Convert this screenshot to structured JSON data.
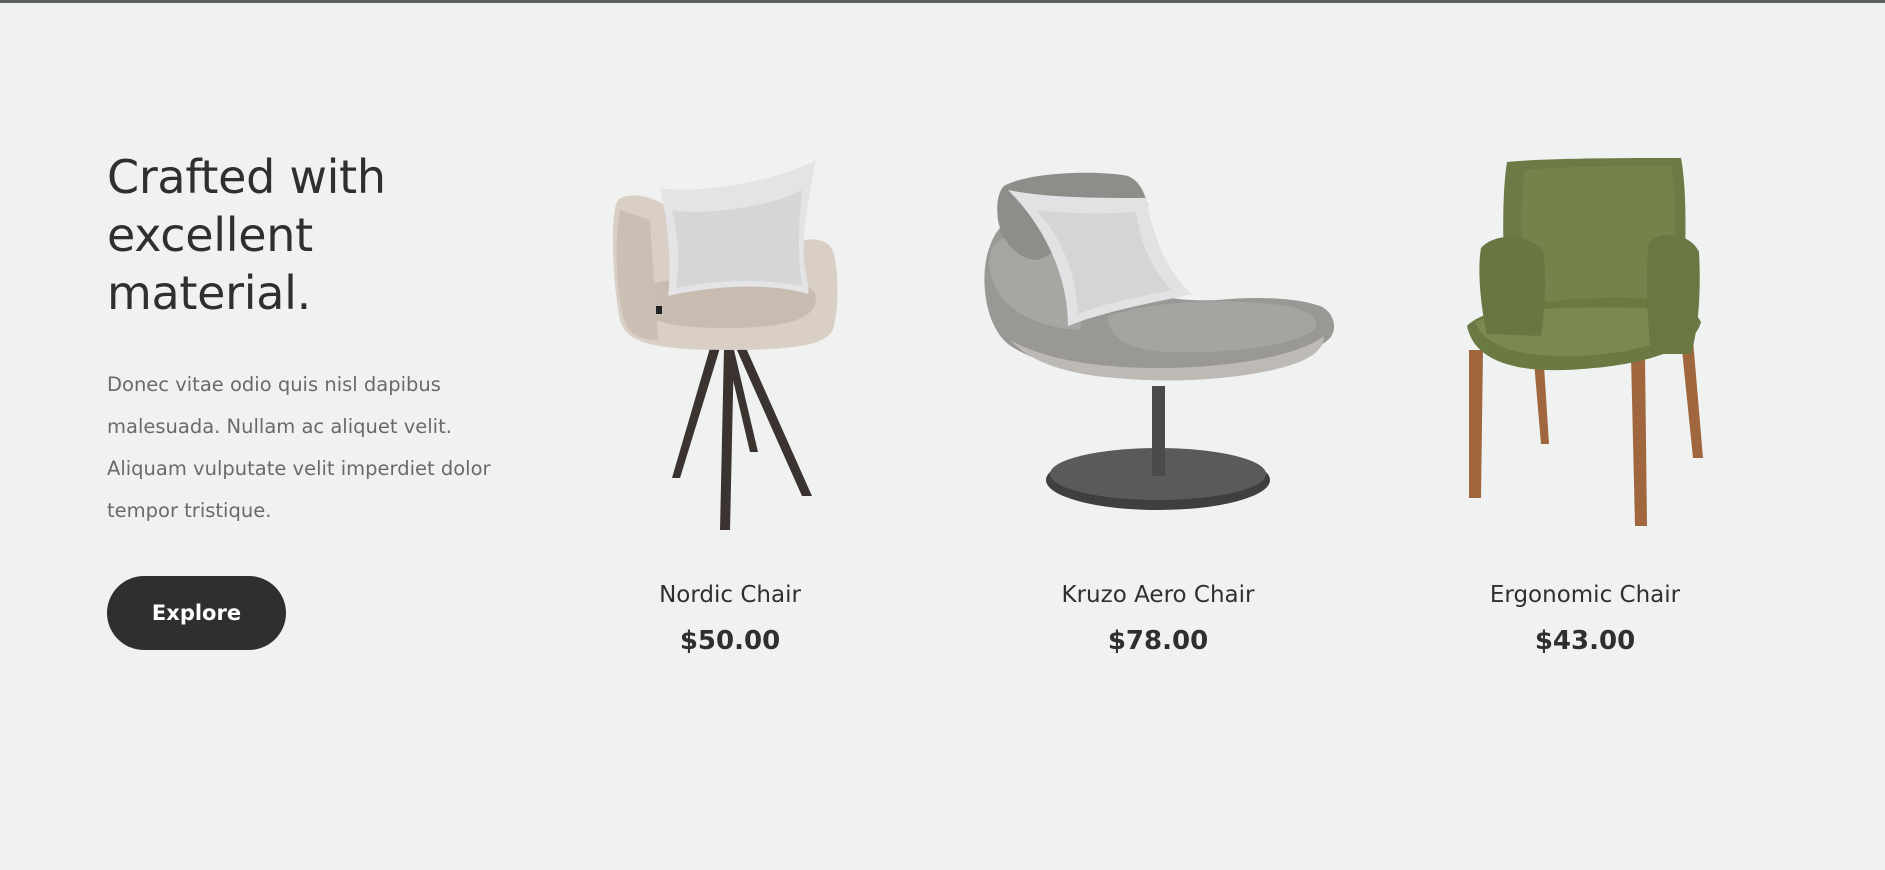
{
  "section": {
    "heading": "Crafted with excellent material.",
    "description": "Donec vitae odio quis nisl dapibus malesuada. Nullam ac aliquet velit. Aliquam vulputate velit imperdiet dolor tempor tristique.",
    "explore_label": "Explore"
  },
  "products": [
    {
      "name": "Nordic Chair",
      "price": "$50.00",
      "icon": "nordic-chair-image"
    },
    {
      "name": "Kruzo Aero Chair",
      "price": "$78.00",
      "icon": "kruzo-aero-chair-image"
    },
    {
      "name": "Ergonomic Chair",
      "price": "$43.00",
      "icon": "ergonomic-chair-image"
    }
  ],
  "colors": {
    "background": "#eff2f1",
    "text": "#2f2f2f",
    "button": "#2f2f2f"
  }
}
